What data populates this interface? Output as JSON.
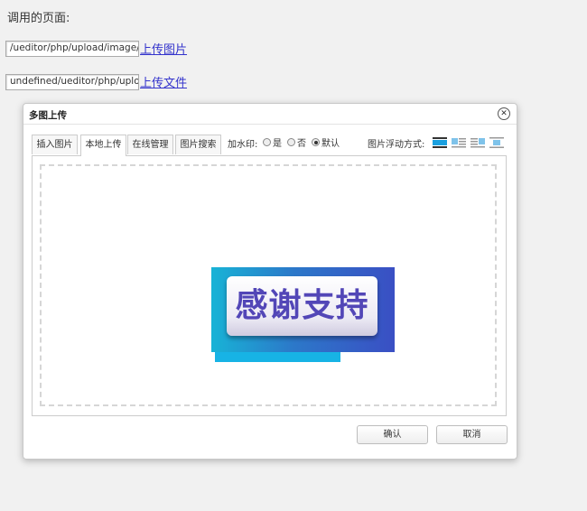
{
  "page": {
    "title": "调用的页面:",
    "image_path": {
      "value": "/ueditor/php/upload/image/20",
      "link": "上传图片"
    },
    "file_path": {
      "value": "undefined/ueditor/php/upload",
      "link": "上传文件"
    }
  },
  "dialog": {
    "title": "多图上传",
    "close_icon": "close-icon",
    "tabs": [
      {
        "label": "插入图片",
        "active": false
      },
      {
        "label": "本地上传",
        "active": true
      },
      {
        "label": "在线管理",
        "active": false
      },
      {
        "label": "图片搜索",
        "active": false
      }
    ],
    "watermark": {
      "label": "加水印:",
      "options": [
        {
          "label": "是",
          "checked": false
        },
        {
          "label": "否",
          "checked": false
        },
        {
          "label": "默认",
          "checked": true
        }
      ]
    },
    "float": {
      "label": "图片浮动方式:",
      "icons": [
        "float-none-icon",
        "float-left-icon",
        "float-right-icon",
        "float-center-icon"
      ]
    },
    "overlay_text": "感谢支持",
    "buttons": {
      "confirm": "确认",
      "cancel": "取消"
    }
  },
  "colors": {
    "link": "#3333cc",
    "pick_button": "#17b3e5",
    "overlay_gradient": [
      "#18b3d6",
      "#3a4fc4"
    ],
    "overlay_text": "#5246b7"
  }
}
